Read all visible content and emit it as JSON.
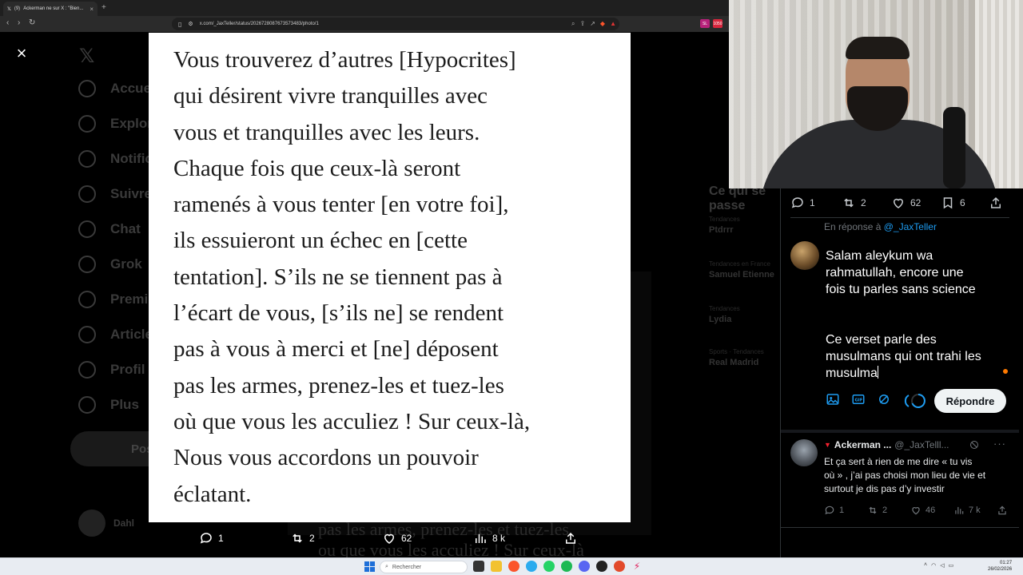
{
  "browser": {
    "tab": {
      "badge": "(9)",
      "title": "Ackerman ne sur X : \"Bien...",
      "close": "×"
    },
    "new_tab": "+",
    "url": "x.com/_JaxTeller/status/2026728087673573483/photo/1",
    "ext_labels": [
      "SL",
      "1050"
    ]
  },
  "background": {
    "nav_items": [
      "Accueil",
      "Explorer",
      "Notifications",
      "Suivre",
      "Chat",
      "Grok",
      "Premium",
      "Articles",
      "Profil",
      "Plus"
    ],
    "post_button": "Poster",
    "user_name": "Dahl",
    "trends_title": "Ce qui se passe",
    "trends": [
      {
        "label": "Tendances",
        "name": "Ptdrrr"
      },
      {
        "label": "Tendances en France",
        "name": "Samuel Etienne"
      },
      {
        "label": "Tendances",
        "name": "Lydia"
      },
      {
        "label": "Sports · Tendances",
        "name": "Real Madrid"
      }
    ],
    "behind_text": "pas les armes, prenez-les et tuez-les\nou que vous les acculiez ! Sur ceux-là"
  },
  "close_icon": "×",
  "photo": {
    "text": "Vous trouverez d’autres [Hypocrites]\nqui désirent vivre tranquilles avec\nvous et tranquilles avec les leurs.\nChaque fois que ceux-là seront\nramenés à vous tenter [en votre foi],\nils essuieront un échec en [cette\ntentation]. S’ils ne se tiennent pas à\nl’écart de vous, [s’ils ne] se rendent\npas à vous à merci et [ne] déposent\npas les armes, prenez-les et tuez-les\noù que vous les acculiez ! Sur ceux-là,\nNous vous accordons un pouvoir\néclatant."
  },
  "photo_actions": {
    "replies": "1",
    "reposts": "2",
    "likes": "62",
    "views": "8 k"
  },
  "right_panel": {
    "stats": {
      "replies": "1",
      "reposts": "2",
      "likes": "62",
      "bookmarks": "6"
    },
    "reply_to_prefix": "En réponse à",
    "reply_to_handle": "@_JaxTeller",
    "compose_text": "Salam aleykum wa\nrahmatullah, encore une\nfois tu parles sans science\n\n\nCe verset parle des\nmusulmans qui ont trahi les\nmusulma",
    "reply_button": "Répondre",
    "tweet": {
      "name": "Ackerman ...",
      "handle": "@_JaxTelll...",
      "more": "···",
      "text": "Et ça sert à rien de me dire « tu vis\noù » , j’ai pas choisi mon lieu de vie et\nsurtout je dis pas d’y investir",
      "replies": "1",
      "reposts": "2",
      "likes": "46",
      "views": "7 k"
    }
  },
  "taskbar": {
    "search_placeholder": "Rechercher",
    "time": "01:27",
    "date": "26/02/2026"
  },
  "colors": {
    "accent": "#1d9bf0",
    "reply_button_bg": "#eff3f4",
    "notification": "#ff7a00",
    "taskbar": "#e8ecf2"
  }
}
